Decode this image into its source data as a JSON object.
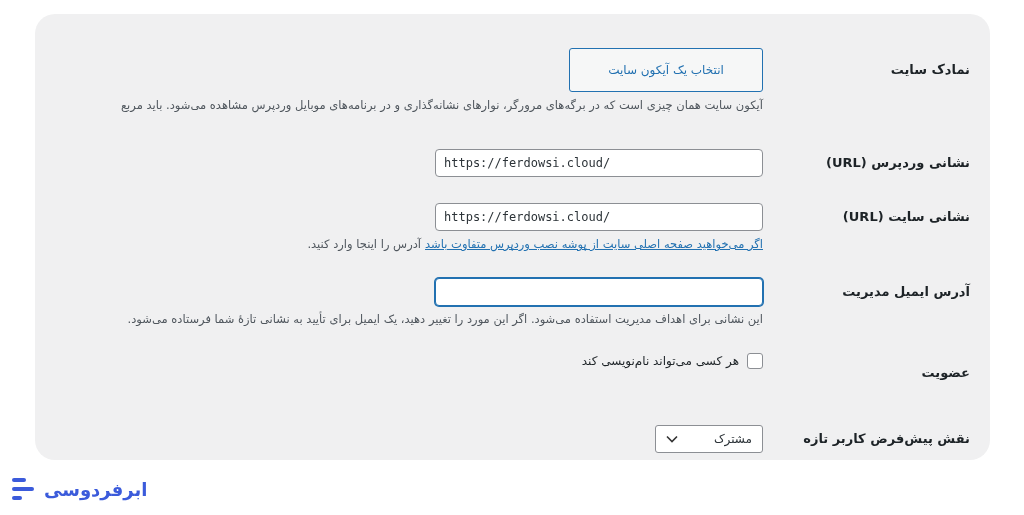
{
  "rows": [
    {
      "kind": "button",
      "label": "نمادک سایت",
      "button": "انتخاب یک آیکون سایت",
      "description": "آیکون سایت همان چیزی است که در برگه‌های مرورگر، نوارهای نشانه‌گذاری و در برنامه‌های موبایل وردپرس مشاهده می‌شود. باید مربع"
    },
    {
      "kind": "input",
      "label": "نشانی وردپرس (URL)",
      "value": "https://ferdowsi.cloud/",
      "focused": false
    },
    {
      "kind": "input",
      "label": "نشانی سایت (URL)",
      "value": "https://ferdowsi.cloud/",
      "focused": false,
      "link": "اگر می‌خواهید صفحه اصلی سایت از پوشه نصب وردپرس متفاوت باشد",
      "description": "آدرس را اینجا وارد کنید."
    },
    {
      "kind": "input",
      "label": "آدرس ایمیل مدیریت",
      "focused": true,
      "description": "این نشانی برای اهداف مدیریت استفاده می‌شود. اگر این مورد را تغییر دهید، یک ایمیل برای تأیید به نشانی تازهٔ شما فرستاده می‌شود."
    },
    {
      "kind": "checkbox",
      "label": "عضویت",
      "option": "هر کسی می‌تواند نام‌نویسی کند",
      "checked": false
    },
    {
      "kind": "select",
      "label": "نقش پیش‌فرض کاربر تازه",
      "value": "مشترک"
    }
  ],
  "brand": {
    "name": "ابرفردوسی"
  }
}
